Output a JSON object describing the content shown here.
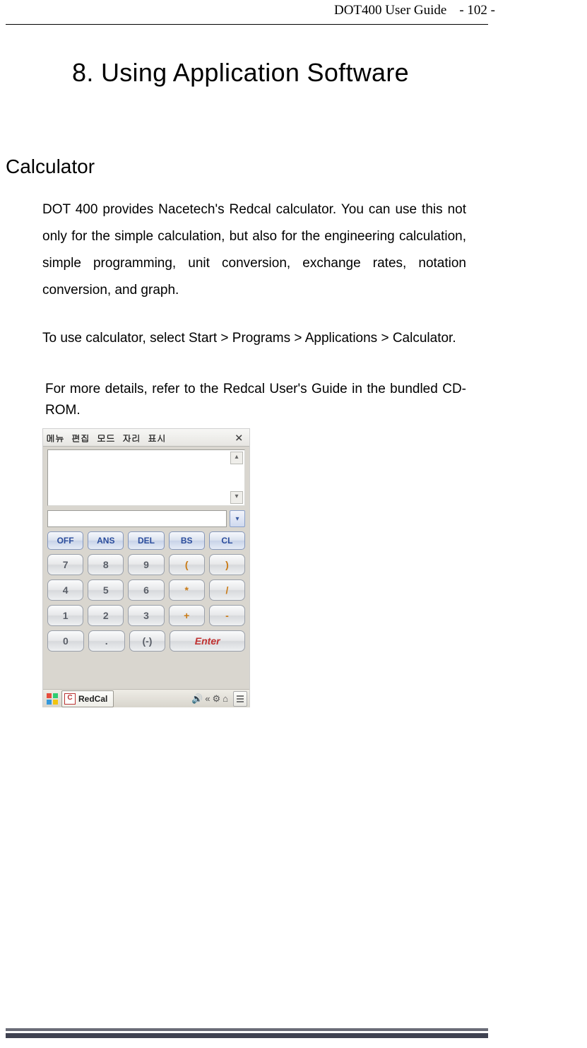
{
  "header": {
    "doc_title": "DOT400 User Guide",
    "page_no": "- 102 -"
  },
  "chapter": {
    "title": "8. Using Application Software"
  },
  "section": {
    "title": "Calculator"
  },
  "paragraphs": {
    "p1": "DOT 400 provides Nacetech's Redcal calculator. You can use this not only for the simple calculation, but also for the engineering calculation, simple programming, unit conversion, exchange rates, notation conversion, and graph.",
    "p2": "To use calculator, select Start > Programs > Applications > Calculator.",
    "p3": "For more details, refer to the Redcal User's Guide in the bundled CD-ROM."
  },
  "calc": {
    "menu": {
      "m1": "메뉴",
      "m2": "편집",
      "m3": "모드",
      "m4": "자리",
      "m5": "표시",
      "close": "×"
    },
    "scroll_up": "▴",
    "scroll_dn": "▾",
    "dd": "▾",
    "func": {
      "off": "OFF",
      "ans": "ANS",
      "del": "DEL",
      "bs": "BS",
      "cl": "CL"
    },
    "keys": {
      "k7": "7",
      "k8": "8",
      "k9": "9",
      "lp": "(",
      "rp": ")",
      "k4": "4",
      "k5": "5",
      "k6": "6",
      "mul": "*",
      "div": "/",
      "k1": "1",
      "k2": "2",
      "k3": "3",
      "add": "+",
      "sub": "-",
      "k0": "0",
      "dot": ".",
      "neg": "(-)",
      "enter": "Enter"
    },
    "taskbar": {
      "app_name": "RedCal",
      "tray": {
        "i1": "🔊",
        "i2": "«",
        "i3": "⚙",
        "i4": "⌂"
      }
    }
  }
}
